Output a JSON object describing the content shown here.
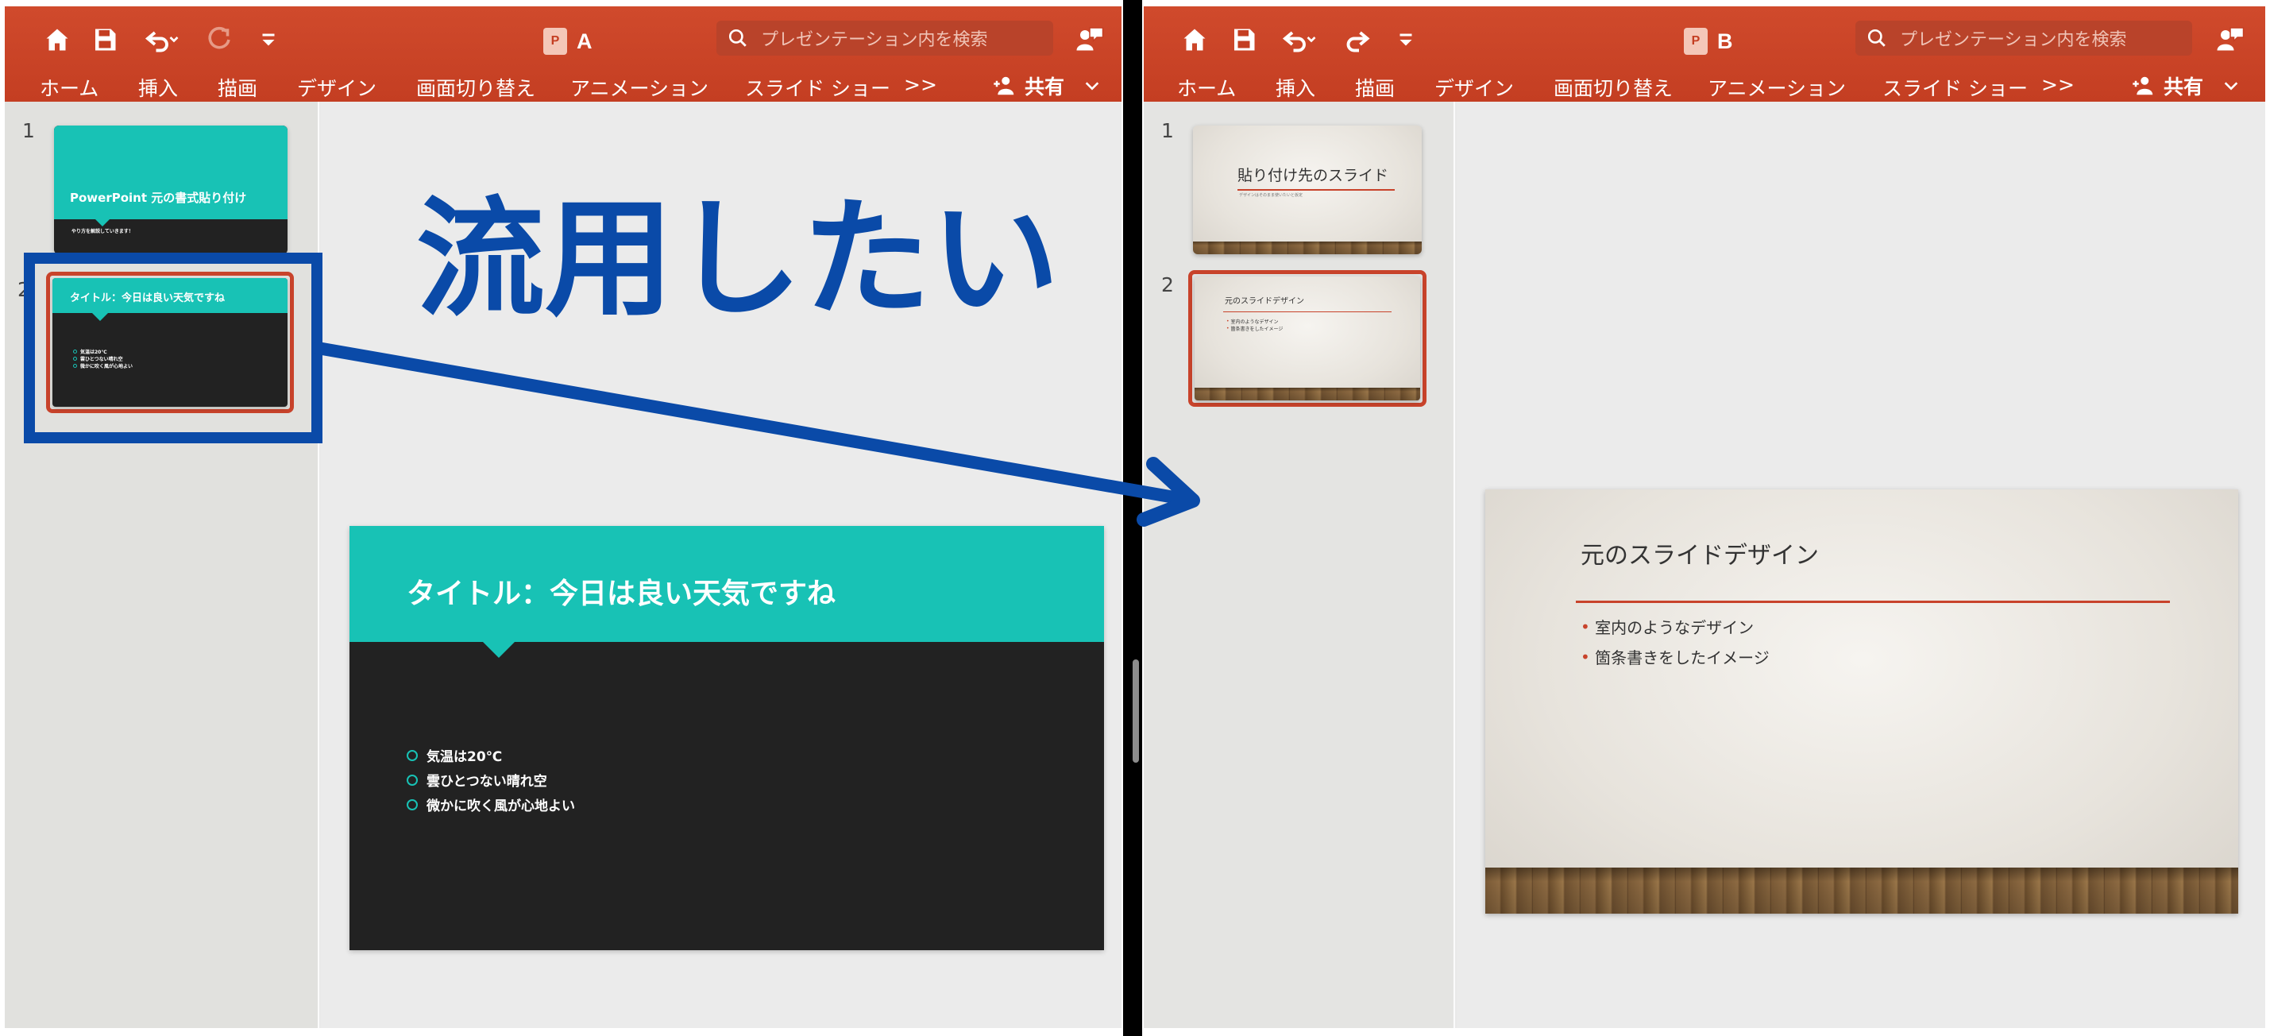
{
  "windowA": {
    "doc_title": "A",
    "search_placeholder": "プレゼンテーション内を検索",
    "tabs": [
      "ホーム",
      "挿入",
      "描画",
      "デザイン",
      "画面切り替え",
      "アニメーション",
      "スライド ショー"
    ],
    "more_tabs": ">>",
    "share_label": "共有",
    "slides": [
      {
        "number": "1",
        "title": "PowerPoint 元の書式貼り付け",
        "subtitle": "やり方を解説していきます！"
      },
      {
        "number": "2",
        "title": "タイトル：今日は良い天気ですね",
        "bullets": [
          "気温は20℃",
          "雲ひとつない晴れ空",
          "微かに吹く風が心地よい"
        ]
      }
    ],
    "active_slide": 2,
    "toolbar_icons": [
      "home-icon",
      "save-icon",
      "undo-icon",
      "redo-icon",
      "customize-icon"
    ]
  },
  "windowB": {
    "doc_title": "B",
    "search_placeholder": "プレゼンテーション内を検索",
    "tabs": [
      "ホーム",
      "挿入",
      "描画",
      "デザイン",
      "画面切り替え",
      "アニメーション",
      "スライド ショー"
    ],
    "more_tabs": ">>",
    "share_label": "共有",
    "slides": [
      {
        "number": "1",
        "title": "貼り付け先のスライド",
        "subtitle": "デザインはそのまま使いたいと仮定"
      },
      {
        "number": "2",
        "title": "元のスライドデザイン",
        "bullets": [
          "室内のようなデザイン",
          "箇条書きをしたイメージ"
        ]
      }
    ],
    "active_slide": 2
  },
  "annotation": {
    "text": "流用したい",
    "color": "#0a4aa8"
  },
  "colors": {
    "ribbon": "#c43e22",
    "teal": "#18c2b5",
    "dark_slide": "#222222",
    "selection": "#c8432b"
  }
}
